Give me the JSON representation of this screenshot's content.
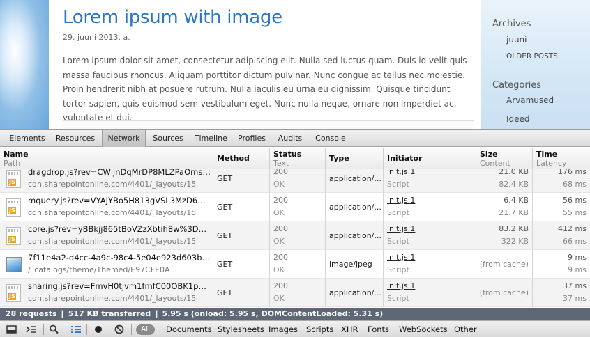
{
  "blog": {
    "title": "Lorem ipsum with image",
    "date": "29. juuni 2013. a.",
    "body": "Lorem ipsum dolor sit amet, consectetur adipiscing elit. Nulla sed luctus quam. Duis id velit quis massa faucibus rhoncus. Aliquam porttitor dictum pulvinar. Nunc congue ac tellus nec molestie. Proin hendrerit nibh at posuere rutrum. Nulla iaculis eu urna eu dignissim. Quisque tincidunt tortor sapien, quis euismod sem vestibulum eget. Nunc nulla neque, ornare non imperdiet ac, vulputate et dui."
  },
  "sidebar": {
    "archives_heading": "Archives",
    "archive_link": "juuni",
    "older_posts": "OLDER POSTS",
    "categories_heading": "Categories",
    "cat1": "Arvamused",
    "cat2": "Ideed"
  },
  "devtools": {
    "tabs": [
      "Elements",
      "Resources",
      "Network",
      "Sources",
      "Timeline",
      "Profiles",
      "Audits",
      "Console"
    ],
    "active_tab": "Network",
    "columns": {
      "name": "Name",
      "name_sub": "Path",
      "method": "Method",
      "status": "Status",
      "status_sub": "Text",
      "type": "Type",
      "initiator": "Initiator",
      "size": "Size",
      "size_sub": "Content",
      "time": "Time",
      "time_sub": "Latency"
    },
    "rows": [
      {
        "name": "dragdrop.js?rev=CWljnDqMrDP8MLZPaOmslg%...",
        "path": "cdn.sharepointonline.com/4401/_layouts/15",
        "method": "GET",
        "status": "200",
        "status_text": "OK",
        "type": "application/...",
        "initiator": "init.js:1",
        "initiator_sub": "Script",
        "size": "21.0 KB",
        "content": "82.4 KB",
        "time": "176 ms",
        "latency": "68 ms",
        "icon": "js-file-icon"
      },
      {
        "name": "mquery.js?rev=VYAJYBo5H813gVSL3MzD6A%3D...",
        "path": "cdn.sharepointonline.com/4401/_layouts/15",
        "method": "GET",
        "status": "200",
        "status_text": "OK",
        "type": "application/...",
        "initiator": "init.js:1",
        "initiator_sub": "Script",
        "size": "6.4 KB",
        "content": "21.7 KB",
        "time": "56 ms",
        "latency": "55 ms",
        "icon": "js-file-icon"
      },
      {
        "name": "core.js?rev=yBBkjj865tBoVZzXbtih8w%3D%3D",
        "path": "cdn.sharepointonline.com/4401/_layouts/15",
        "method": "GET",
        "status": "200",
        "status_text": "OK",
        "type": "application/...",
        "initiator": "init.js:1",
        "initiator_sub": "Script",
        "size": "83.2 KB",
        "content": "322 KB",
        "time": "412 ms",
        "latency": "66 ms",
        "icon": "js-file-icon"
      },
      {
        "name": "7f11e4a2-d4cc-4a9c-98c4-5e04e923d603bkimage...",
        "path": "/_catalogs/theme/Themed/E97CFE0A",
        "method": "GET",
        "status": "200",
        "status_text": "OK",
        "type": "image/jpeg",
        "initiator": "init.js:1",
        "initiator_sub": "Script",
        "size": "(from cache)",
        "content": "",
        "time": "9 ms",
        "latency": "9 ms",
        "icon": "image-file-icon"
      },
      {
        "name": "sharing.js?rev=FmvH0tjvm1fmfC00OBK1pA%3D...",
        "path": "cdn.sharepointonline.com/4401/_layouts/15",
        "method": "GET",
        "status": "200",
        "status_text": "OK",
        "type": "application/...",
        "initiator": "init.js:1",
        "initiator_sub": "Script",
        "size": "(from cache)",
        "content": "",
        "time": "37 ms",
        "latency": "37 ms",
        "icon": "js-file-icon"
      }
    ],
    "summary": {
      "requests": "28 requests",
      "transferred": "517 KB transferred",
      "timing": "5.95 s (onload: 5.95 s, DOMContentLoaded: 5.31 s)",
      "separator": "❙"
    },
    "js_badge": "JS",
    "filters": [
      "All",
      "Documents",
      "Stylesheets",
      "Images",
      "Scripts",
      "XHR",
      "Fonts",
      "WebSockets",
      "Other"
    ],
    "colors": {
      "summary_bg": "#5e6775",
      "title_blue": "#2e78c2",
      "record_dot": "#222222"
    }
  }
}
